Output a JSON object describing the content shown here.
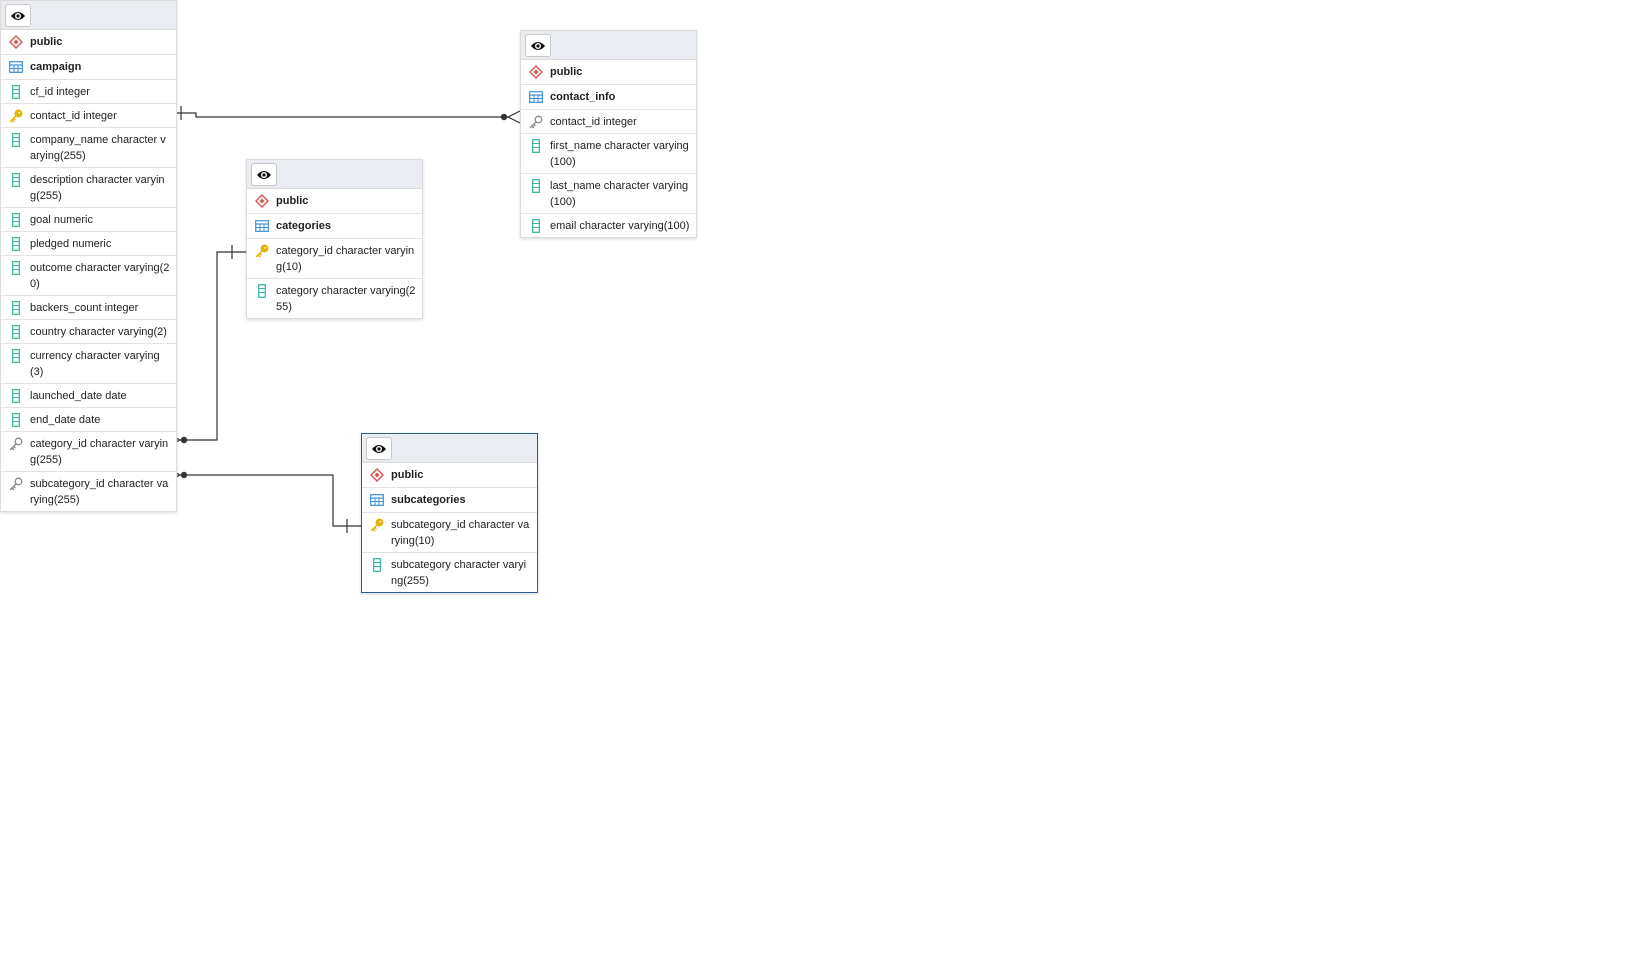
{
  "tables": {
    "campaign": {
      "schema": "public",
      "name": "campaign",
      "columns": [
        {
          "text": "cf_id integer",
          "icon": "column-icon"
        },
        {
          "text": "contact_id integer",
          "icon": "primary-key-icon"
        },
        {
          "text": "company_name character varying(255)",
          "icon": "column-icon"
        },
        {
          "text": "description character varying(255)",
          "icon": "column-icon"
        },
        {
          "text": "goal numeric",
          "icon": "column-icon"
        },
        {
          "text": "pledged numeric",
          "icon": "column-icon"
        },
        {
          "text": "outcome character varying(20)",
          "icon": "column-icon"
        },
        {
          "text": "backers_count integer",
          "icon": "column-icon"
        },
        {
          "text": "country character varying(2)",
          "icon": "column-icon"
        },
        {
          "text": "currency character varying(3)",
          "icon": "column-icon"
        },
        {
          "text": "launched_date date",
          "icon": "column-icon"
        },
        {
          "text": "end_date date",
          "icon": "column-icon"
        },
        {
          "text": "category_id character varying(255)",
          "icon": "foreign-key-icon"
        },
        {
          "text": "subcategory_id character varying(255)",
          "icon": "foreign-key-icon"
        }
      ]
    },
    "contact_info": {
      "schema": "public",
      "name": "contact_info",
      "columns": [
        {
          "text": "contact_id integer",
          "icon": "foreign-key-icon"
        },
        {
          "text": "first_name character varying(100)",
          "icon": "column-icon"
        },
        {
          "text": "last_name character varying(100)",
          "icon": "column-icon"
        },
        {
          "text": "email character varying(100)",
          "icon": "column-icon"
        }
      ]
    },
    "categories": {
      "schema": "public",
      "name": "categories",
      "columns": [
        {
          "text": "category_id character varying(10)",
          "icon": "primary-key-icon"
        },
        {
          "text": "category character varying(255)",
          "icon": "column-icon"
        }
      ]
    },
    "subcategories": {
      "schema": "public",
      "name": "subcategories",
      "columns": [
        {
          "text": "subcategory_id character varying(10)",
          "icon": "primary-key-icon"
        },
        {
          "text": "subcategory character varying(255)",
          "icon": "column-icon"
        }
      ]
    }
  },
  "colors": {
    "schema_icon": "#d9534f",
    "table_icon": "#3a8fd6",
    "column_icon": "#2fb3a0",
    "primary_key_icon": "#e2b400",
    "foreign_key_icon": "#8a8a8a",
    "link_line": "#333333",
    "header_bg": "#e9ecf0",
    "selected_border": "#2c5d8a"
  }
}
